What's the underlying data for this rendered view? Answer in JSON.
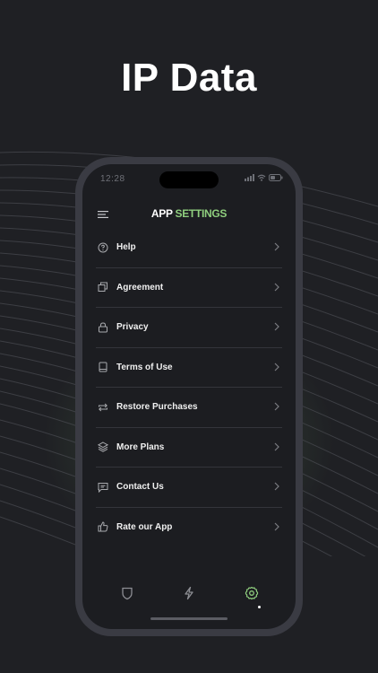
{
  "hero": {
    "title": "IP Data"
  },
  "status_bar": {
    "time": "12:28"
  },
  "header": {
    "title_part1": "APP",
    "title_part2": "SETTINGS"
  },
  "menu": {
    "items": [
      {
        "label": "Help",
        "icon": "help-circle-icon"
      },
      {
        "label": "Agreement",
        "icon": "copy-icon"
      },
      {
        "label": "Privacy",
        "icon": "lock-icon"
      },
      {
        "label": "Terms of Use",
        "icon": "book-icon"
      },
      {
        "label": "Restore Purchases",
        "icon": "repeat-icon"
      },
      {
        "label": "More Plans",
        "icon": "layers-icon"
      },
      {
        "label": "Contact Us",
        "icon": "message-icon"
      },
      {
        "label": "Rate our App",
        "icon": "thumbs-up-icon"
      }
    ]
  },
  "tabbar": {
    "tabs": [
      {
        "icon": "shield-icon",
        "active": false
      },
      {
        "icon": "lightning-icon",
        "active": false
      },
      {
        "icon": "gear-icon",
        "active": true
      }
    ]
  },
  "colors": {
    "background": "#1f2024",
    "accent": "#8fce7e",
    "phone_frame": "#3a3b43",
    "screen": "#1c1d21"
  }
}
